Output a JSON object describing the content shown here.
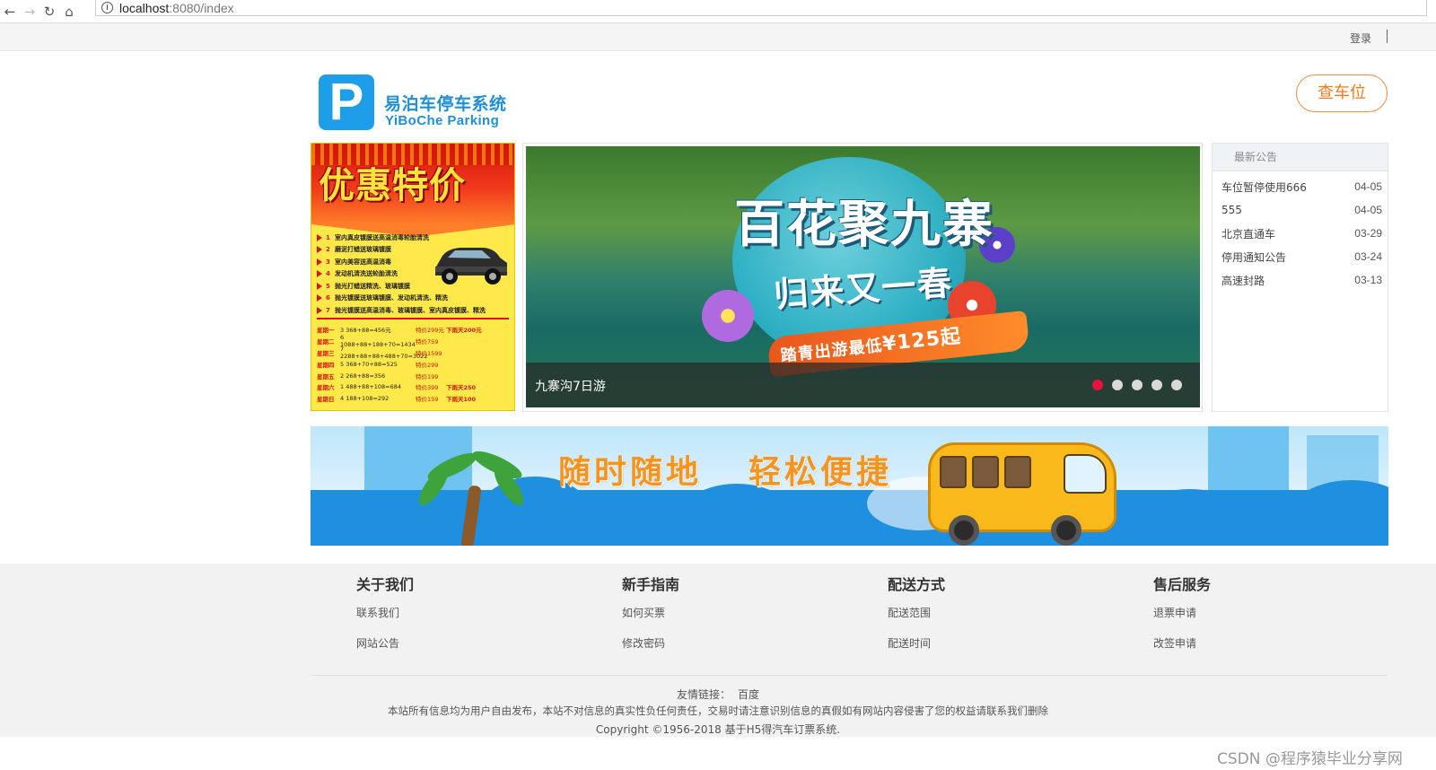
{
  "browser": {
    "url_host": "localhost",
    "url_rest": ":8080/index"
  },
  "topbar": {
    "login": "登录"
  },
  "header": {
    "logo_letter": "P",
    "logo_cn": "易泊车停车系统",
    "logo_en": "YiBoChe  Parking",
    "check_button": "查车位"
  },
  "promo": {
    "title": "优惠特价",
    "items": [
      {
        "n": "1",
        "t": "室内真皮镀膜送高温消毒轮胎清洗"
      },
      {
        "n": "2",
        "t": "磨泥打蜡送玻璃镀膜"
      },
      {
        "n": "3",
        "t": "室内美容送高温消毒"
      },
      {
        "n": "4",
        "t": "发动机清洗送轮胎清洗"
      },
      {
        "n": "5",
        "t": "抛光打蜡送精洗、玻璃镀膜"
      },
      {
        "n": "6",
        "t": "抛光镀膜送玻璃镀膜、发动机清洗、精洗"
      },
      {
        "n": "7",
        "t": "抛光镀膜送高温消毒、玻璃镀膜、室内真皮镀膜、精洗"
      }
    ],
    "rows": [
      {
        "d": "星期一",
        "f": "3  368+88=456元",
        "p": "特价299元",
        "r": "下雨天200元"
      },
      {
        "d": "星期二",
        "f": "6  1088+88+188+70=1434",
        "p": "特价759",
        "r": ""
      },
      {
        "d": "星期三",
        "f": "7  2288+88+88+488+70=3022",
        "p": "特价1599",
        "r": ""
      },
      {
        "d": "星期四",
        "f": "5  368+70+88=525",
        "p": "特价299",
        "r": ""
      },
      {
        "d": "星期五",
        "f": "2  268+88=356",
        "p": "特价199",
        "r": ""
      },
      {
        "d": "星期六",
        "f": "1  488+88+108=684",
        "p": "特价399",
        "r": "下雨天250"
      },
      {
        "d": "星期日",
        "f": "4  188+108=292",
        "p": "特价159",
        "r": "下雨天100"
      }
    ]
  },
  "carousel": {
    "title_line1": "百花聚九寨",
    "title_line2": "归来又一春",
    "promo_text": "踏青出游最低",
    "promo_price": "¥125起",
    "caption": "九寨沟7日游",
    "dots": 5,
    "active_dot": 0
  },
  "notices": {
    "heading": "最新公告",
    "items": [
      {
        "title": "车位暂停使用666",
        "date": "04-05"
      },
      {
        "title": "555",
        "date": "04-05"
      },
      {
        "title": "北京直通车",
        "date": "03-29"
      },
      {
        "title": "停用通知公告",
        "date": "03-24"
      },
      {
        "title": "高速封路",
        "date": "03-13"
      }
    ]
  },
  "banner": {
    "text1": "随时随地",
    "text2": "轻松便捷"
  },
  "footer": {
    "columns": [
      {
        "title": "关于我们",
        "links": [
          "联系我们",
          "网站公告"
        ]
      },
      {
        "title": "新手指南",
        "links": [
          "如何买票",
          "修改密码"
        ]
      },
      {
        "title": "配送方式",
        "links": [
          "配送范围",
          "配送时间"
        ]
      },
      {
        "title": "售后服务",
        "links": [
          "退票申请",
          "改签申请"
        ]
      }
    ],
    "friends_label": "友情链接：",
    "friends_link": "百度",
    "disclaimer": "本站所有信息均为用户自由发布，本站不对信息的真实性负任何责任，交易时请注意识别信息的真假如有网站内容侵害了您的权益请联系我们删除",
    "copyright": "Copyright ©1956-2018 基于H5得汽车订票系统."
  },
  "watermark": "CSDN @程序猿毕业分享网",
  "colors": {
    "brand_blue": "#1e9ee8",
    "accent_orange": "#f07a20",
    "active_dot": "#e8123a"
  }
}
